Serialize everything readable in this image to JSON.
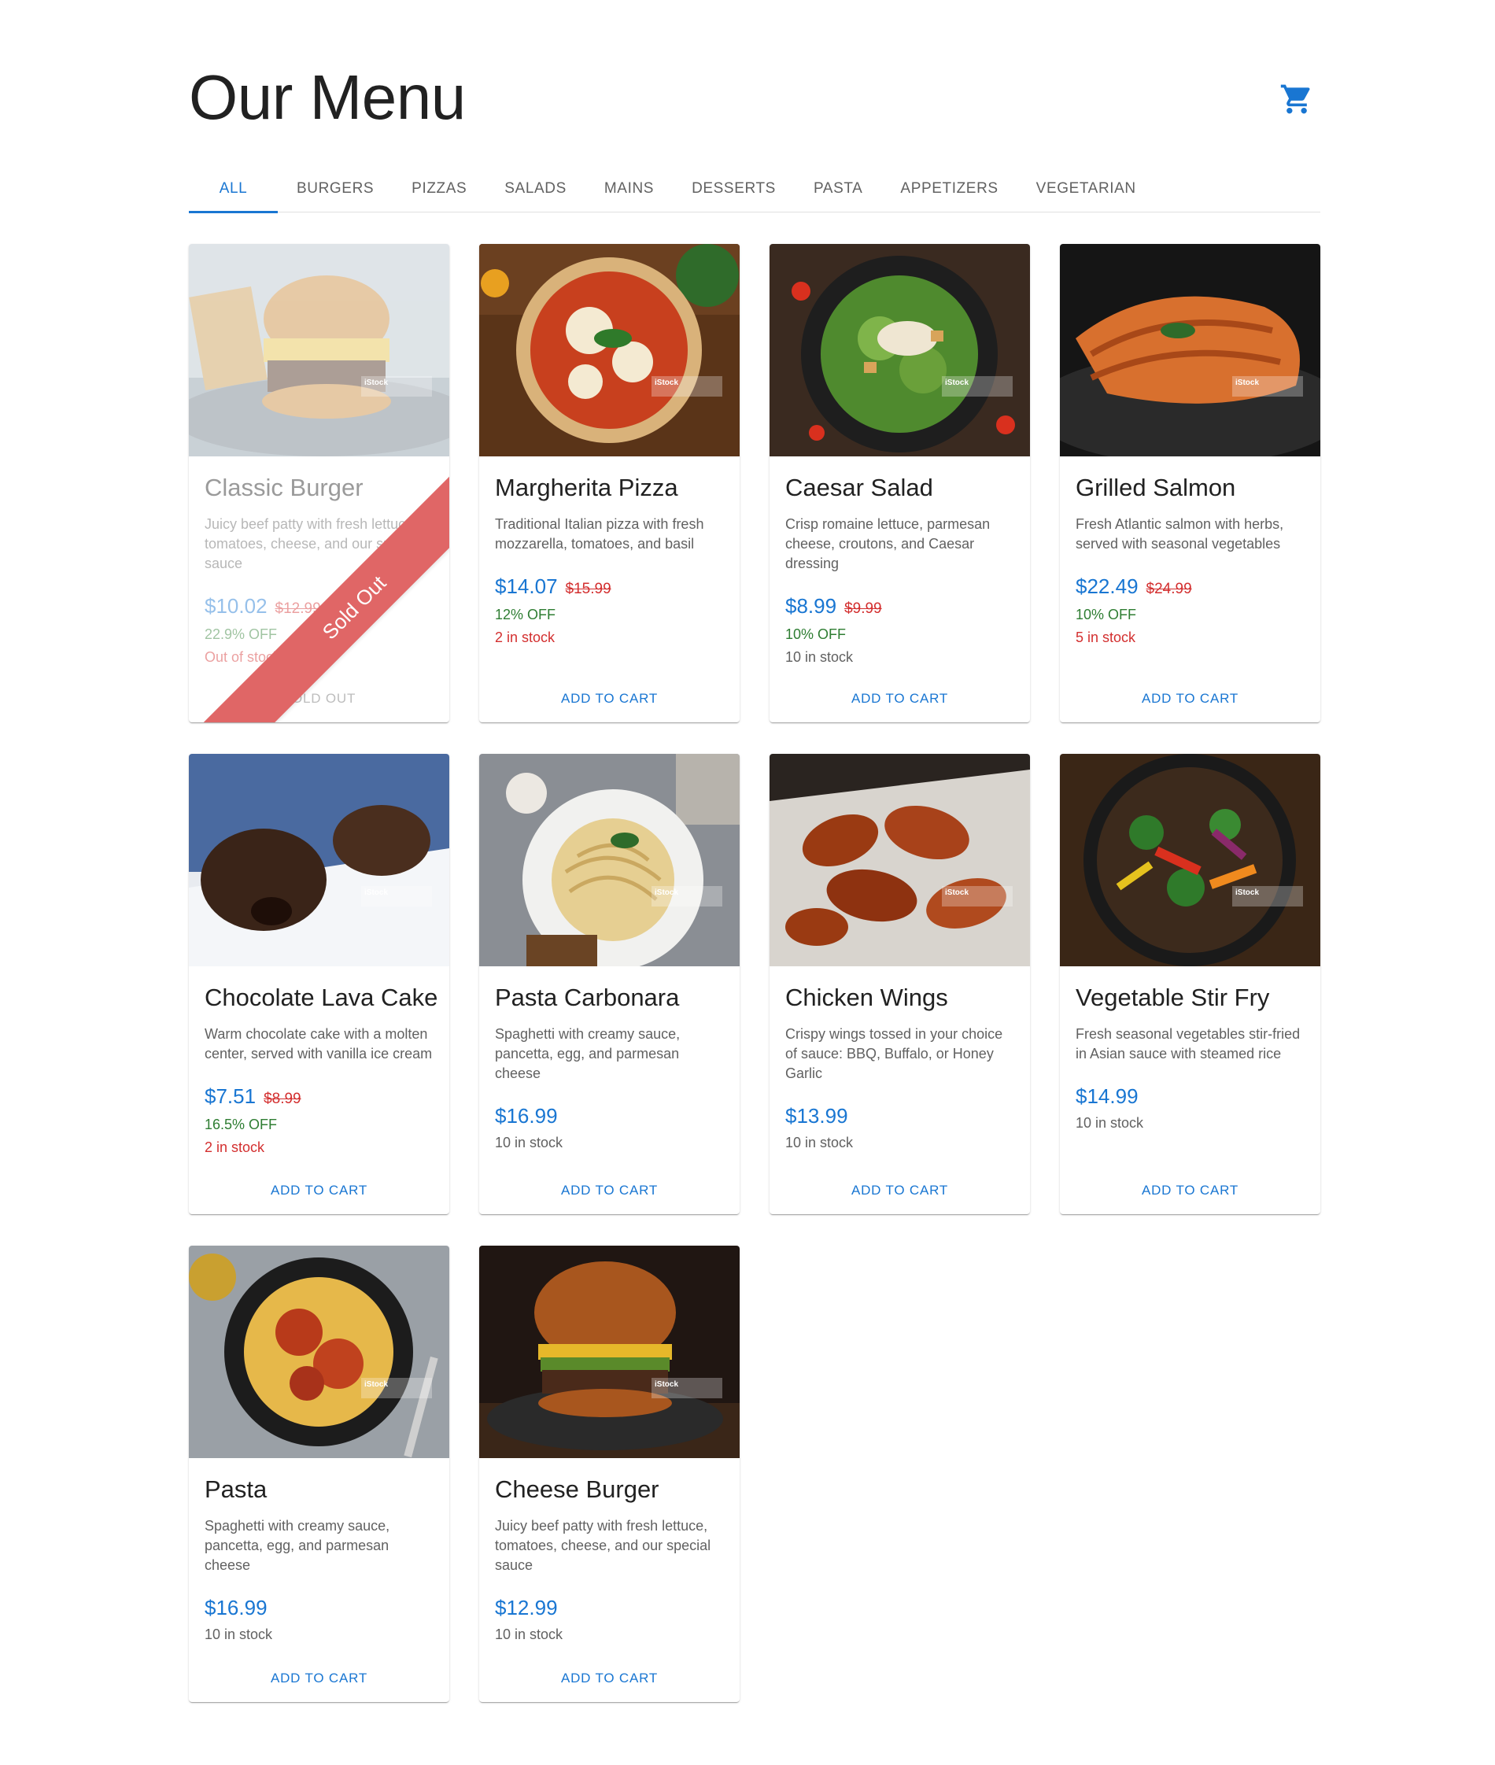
{
  "header": {
    "title": "Our Menu",
    "cart_icon": "shopping-cart-icon"
  },
  "tabs": [
    "ALL",
    "BURGERS",
    "PIZZAS",
    "SALADS",
    "MAINS",
    "DESSERTS",
    "PASTA",
    "APPETIZERS",
    "VEGETARIAN"
  ],
  "active_tab": "ALL",
  "watermark": "iStock",
  "colors": {
    "primary": "#1976d2",
    "price_old": "#d32f2f",
    "discount": "#2e7d32",
    "sold_banner": "#e06666"
  },
  "items": [
    {
      "title": "Classic Burger",
      "description": "Juicy beef patty with fresh lettuce, tomatoes, cheese, and our special sauce",
      "price": "$10.02",
      "old_price": "$12.99",
      "discount": "22.9% OFF",
      "stock": "Out of stock",
      "action": "SOLD OUT",
      "banner": "Sold Out",
      "sold_out": true
    },
    {
      "title": "Margherita Pizza",
      "description": "Traditional Italian pizza with fresh mozzarella, tomatoes, and basil",
      "price": "$14.07",
      "old_price": "$15.99",
      "discount": "12% OFF",
      "stock": "2 in stock",
      "action": "ADD TO CART"
    },
    {
      "title": "Caesar Salad",
      "description": "Crisp romaine lettuce, parmesan cheese, croutons, and Caesar dressing",
      "price": "$8.99",
      "old_price": "$9.99",
      "discount": "10% OFF",
      "stock": "10 in stock",
      "action": "ADD TO CART"
    },
    {
      "title": "Grilled Salmon",
      "description": "Fresh Atlantic salmon with herbs, served with seasonal vegetables",
      "price": "$22.49",
      "old_price": "$24.99",
      "discount": "10% OFF",
      "stock": "5 in stock",
      "action": "ADD TO CART"
    },
    {
      "title": "Chocolate Lava Cake",
      "description": "Warm chocolate cake with a molten center, served with vanilla ice cream",
      "price": "$7.51",
      "old_price": "$8.99",
      "discount": "16.5% OFF",
      "stock": "2 in stock",
      "action": "ADD TO CART"
    },
    {
      "title": "Pasta Carbonara",
      "description": "Spaghetti with creamy sauce, pancetta, egg, and parmesan cheese",
      "price": "$16.99",
      "stock": "10 in stock",
      "action": "ADD TO CART"
    },
    {
      "title": "Chicken Wings",
      "description": "Crispy wings tossed in your choice of sauce: BBQ, Buffalo, or Honey Garlic",
      "price": "$13.99",
      "stock": "10 in stock",
      "action": "ADD TO CART"
    },
    {
      "title": "Vegetable Stir Fry",
      "description": "Fresh seasonal vegetables stir-fried in Asian sauce with steamed rice",
      "price": "$14.99",
      "stock": "10 in stock",
      "action": "ADD TO CART"
    },
    {
      "title": "Pasta",
      "description": "Spaghetti with creamy sauce, pancetta, egg, and parmesan cheese",
      "price": "$16.99",
      "stock": "10 in stock",
      "action": "ADD TO CART"
    },
    {
      "title": "Cheese Burger",
      "description": "Juicy beef patty with fresh lettuce, tomatoes, cheese, and our special sauce",
      "price": "$12.99",
      "stock": "10 in stock",
      "action": "ADD TO CART"
    }
  ]
}
